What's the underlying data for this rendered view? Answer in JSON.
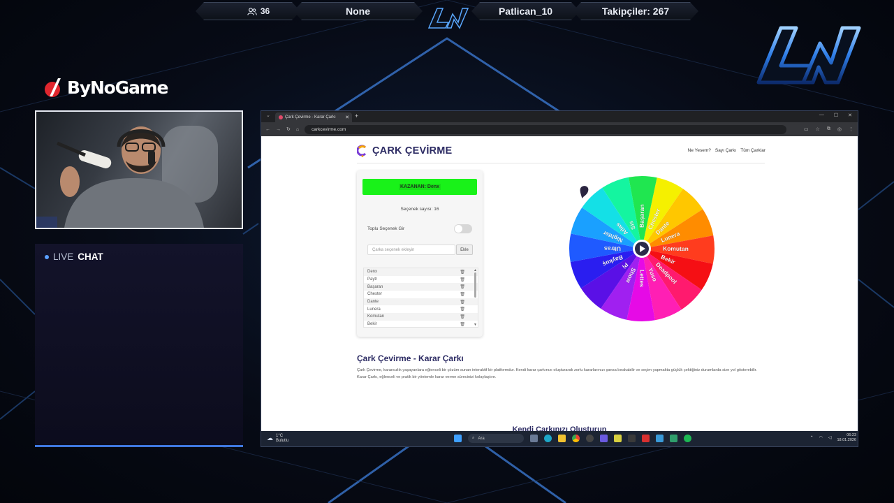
{
  "stream_bar": {
    "viewers": "36",
    "status": "None",
    "streamer": "Patlican_10",
    "followers": "Takipçiler: 267"
  },
  "brand": {
    "name": "ByNoGame"
  },
  "chat": {
    "live": "LIVE",
    "title": "CHAT"
  },
  "browser": {
    "tab_title": "Çark Çevirme - Karar Çarkı",
    "url": "carkcevirme.com",
    "site_title": "ÇARK ÇEVİRME",
    "nav": [
      "Ne Yesem?",
      "Sayı Çarkı",
      "Tüm Çarklar"
    ],
    "winner": "KAZANAN: Denx",
    "option_count": "Seçenek sayısı: 16",
    "bulk_label": "Toplu Seçenek Gir",
    "bulk_enabled": false,
    "input_placeholder": "Çarka seçenek ekleyin",
    "add_button": "Ekle",
    "options": [
      "Denx",
      "Paytr",
      "Başaran",
      "Chester",
      "Dante",
      "Lunera",
      "Komutan",
      "Bekir"
    ],
    "wheel_labels": [
      "Chester",
      "Dante",
      "Lunera",
      "Komutan",
      "Bekir",
      "Deadpool",
      "Yuso",
      "Lettes",
      "Show",
      "Pi",
      "Baykuş",
      "Ultras",
      "Nighter",
      "Atlas",
      "Sis",
      "Başaran"
    ],
    "wheel_colors": [
      "#f5f000",
      "#ffc700",
      "#ff8c00",
      "#ff3c1e",
      "#f50f14",
      "#ff1a6e",
      "#ff1fb4",
      "#e60ae6",
      "#a020f0",
      "#5a10e6",
      "#2a1ef0",
      "#1f5aff",
      "#1aa0ff",
      "#14e0e6",
      "#14f5a0",
      "#20e650",
      "#6ee614",
      "#b4f00a"
    ],
    "section_title": "Çark Çevirme - Karar Çarkı",
    "section_text": "Çark Çevirme, kararsızlık yaşayanlara eğlenceli bir çözüm sunan interaktif bir platformdur. Kendi karar çarkınızı oluşturarak zorlu kararlarınızı şansa bırakabilir ve seçim yapmakta güçlük çektiğiniz durumlarda size yol gösterebilir. Karar Çarkı, eğlenceli ve pratik bir yöntemle karar verme sürecinizi kolaylaştırır.",
    "next_heading": "Kendi Çarkınızı Oluşturun"
  },
  "taskbar": {
    "temp": "1°C",
    "weather": "Bulutlu",
    "search": "Ara",
    "time": "06:23",
    "date": "18.01.2026"
  }
}
